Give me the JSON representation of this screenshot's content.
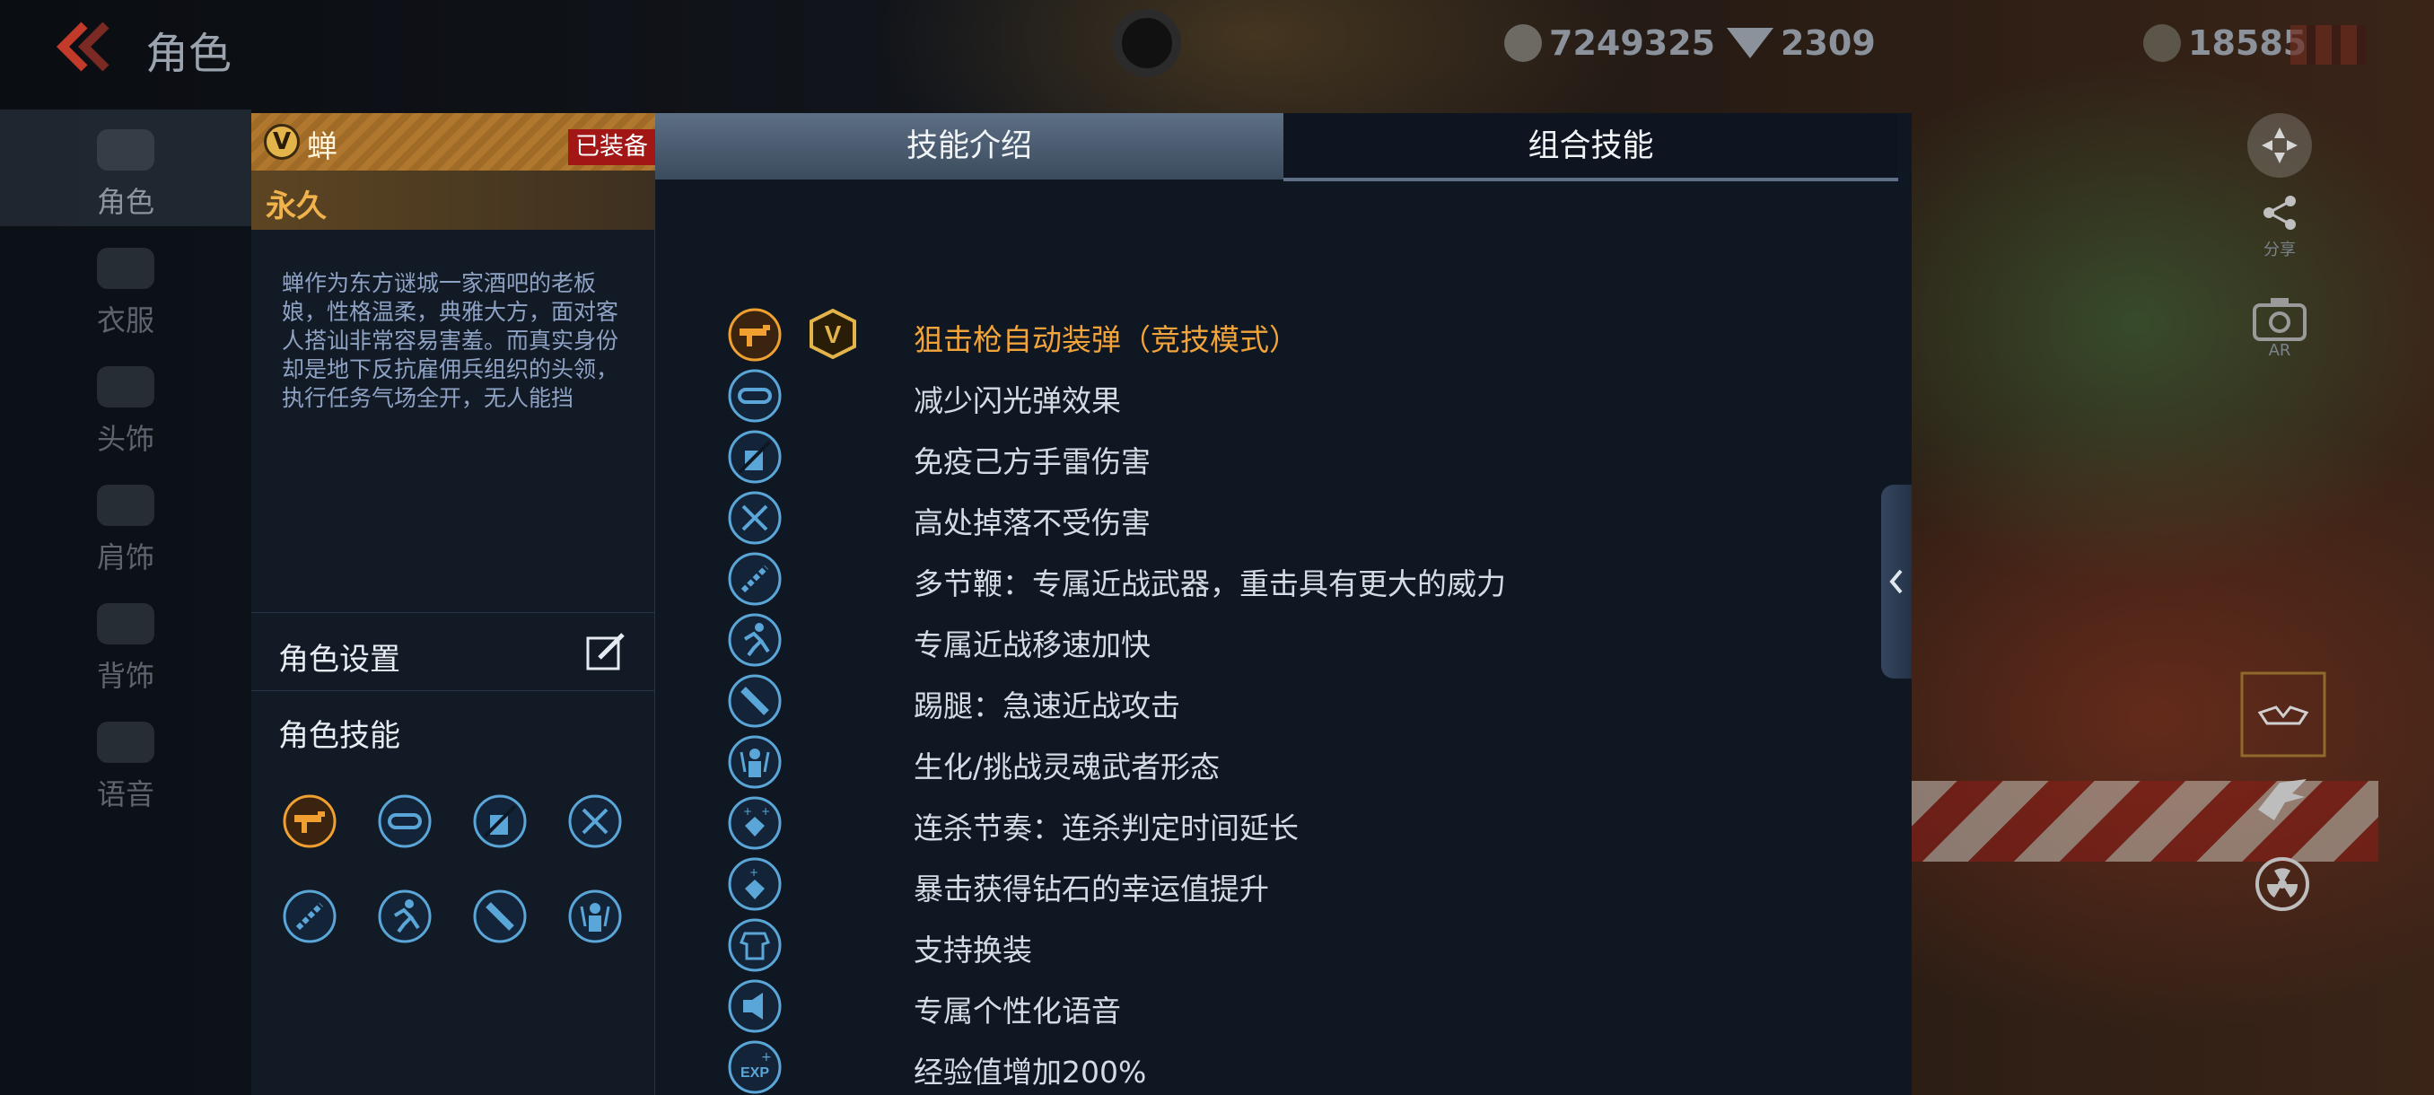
{
  "topbar": {
    "title": "角色",
    "currencies": [
      {
        "icon": "gold-coin-icon",
        "value": "7249325"
      },
      {
        "icon": "diamond-icon",
        "value": "2309"
      },
      {
        "icon": "token-icon",
        "value": "18585"
      }
    ]
  },
  "nav": {
    "items": [
      {
        "label": "角色",
        "icon": "character-icon"
      },
      {
        "label": "衣服",
        "icon": "clothes-icon"
      },
      {
        "label": "头饰",
        "icon": "headwear-icon"
      },
      {
        "label": "肩饰",
        "icon": "shoulder-icon"
      },
      {
        "label": "背饰",
        "icon": "back-accessory-icon"
      },
      {
        "label": "语音",
        "icon": "voice-icon"
      }
    ]
  },
  "character": {
    "vip_mark": "V",
    "name": "蝉",
    "equipped": "已装备",
    "duration": "永久",
    "description": "蝉作为东方谜城一家酒吧的老板娘，性格温柔，典雅大方，面对客人搭讪非常容易害羞。而真实身份却是地下反抗雇佣兵组织的头领，执行任务气场全开，无人能挡",
    "settings_label": "角色设置",
    "skills_label": "角色技能"
  },
  "tabs": {
    "intro": "技能介绍",
    "combo": "组合技能"
  },
  "skills": [
    {
      "label": "狙击枪自动装弹（竞技模式）",
      "icon": "sniper-reload-icon",
      "vip": true
    },
    {
      "label": "减少闪光弹效果",
      "icon": "goggles-icon"
    },
    {
      "label": "免疫己方手雷伤害",
      "icon": "grenade-immune-icon"
    },
    {
      "label": "高处掉落不受伤害",
      "icon": "fall-damage-icon"
    },
    {
      "label": "多节鞭：专属近战武器，重击具有更大的威力",
      "icon": "whip-icon"
    },
    {
      "label": "专属近战移速加快",
      "icon": "run-icon"
    },
    {
      "label": "踢腿：急速近战攻击",
      "icon": "kick-icon"
    },
    {
      "label": "生化/挑战灵魂武者形态",
      "icon": "soul-warrior-icon"
    },
    {
      "label": "连杀节奏：连杀判定时间延长",
      "icon": "diamond-sparkle-icon"
    },
    {
      "label": "暴击获得钻石的幸运值提升",
      "icon": "diamond-luck-icon"
    },
    {
      "label": "支持换装",
      "icon": "outfit-change-icon"
    },
    {
      "label": "专属个性化语音",
      "icon": "voice-icon"
    },
    {
      "label": "经验值增加200%",
      "icon": "exp-icon",
      "icon_text": "EXP"
    }
  ],
  "side": {
    "share_label": "分享",
    "ar_label": "AR"
  },
  "colors": {
    "accent_orange": "#f2a43a",
    "icon_blue": "#5aa6d8",
    "equipped_red": "#a31616"
  }
}
